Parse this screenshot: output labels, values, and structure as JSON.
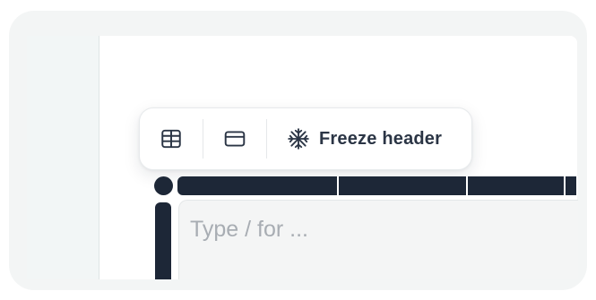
{
  "toolbar": {
    "buttons": [
      {
        "icon": "table-icon"
      },
      {
        "icon": "card-icon"
      },
      {
        "icon": "snowflake-icon",
        "label": "Freeze header"
      }
    ]
  },
  "table": {
    "cell_placeholder": "Type / for ..."
  },
  "colors": {
    "handle": "#1d2737",
    "toolbar_text": "#2b3545",
    "placeholder": "#a8adb3"
  }
}
